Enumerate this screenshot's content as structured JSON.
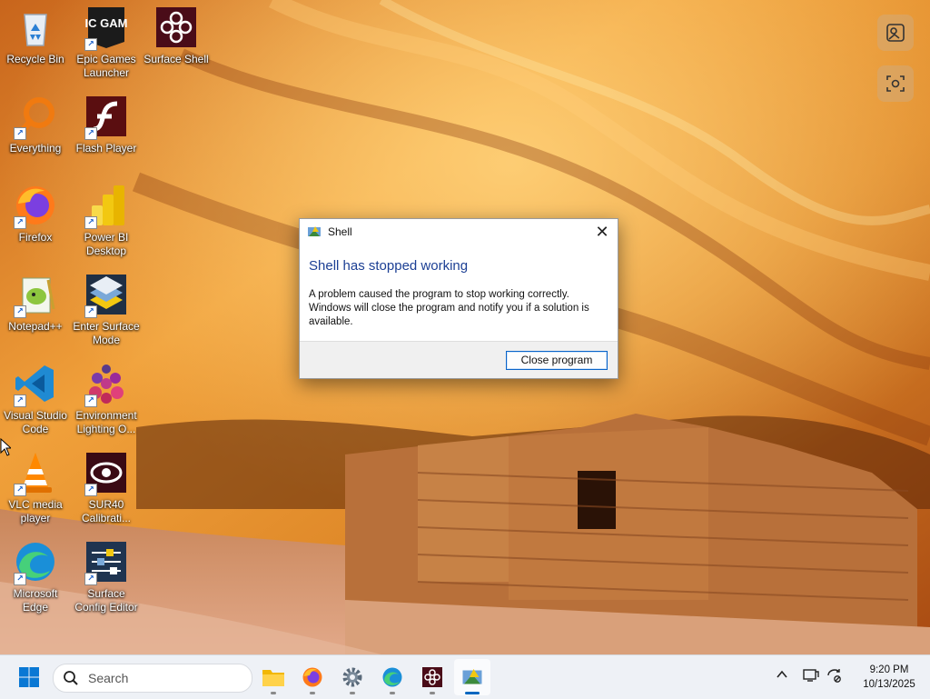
{
  "desktop": {
    "icons": [
      {
        "label": "Recycle Bin"
      },
      {
        "label": "Epic Games Launcher"
      },
      {
        "label": "Surface Shell"
      },
      {
        "label": "Everything"
      },
      {
        "label": "Flash Player"
      },
      {
        "label": "Firefox"
      },
      {
        "label": "Power BI Desktop"
      },
      {
        "label": "Notepad++"
      },
      {
        "label": "Enter Surface Mode"
      },
      {
        "label": "Visual Studio Code"
      },
      {
        "label": "Environment Lighting O..."
      },
      {
        "label": "VLC media player"
      },
      {
        "label": "SUR40 Calibrati..."
      },
      {
        "label": "Microsoft Edge"
      },
      {
        "label": "Surface Config Editor"
      }
    ],
    "epic_logo_text": "EPIC GAMES"
  },
  "dialog": {
    "title": "Shell",
    "heading": "Shell has stopped working",
    "message": "A problem caused the program to stop working correctly. Windows will close the program and notify you if a solution is available.",
    "close_button": "Close program",
    "close_glyph": "✕"
  },
  "taskbar": {
    "search_placeholder": "Search",
    "apps": [
      "file-explorer",
      "firefox",
      "settings",
      "microsoft-edge",
      "surface-shell",
      "shell-app"
    ],
    "active_app": "shell-app"
  },
  "tray": {
    "time": "9:20 PM",
    "date": "10/13/2025"
  },
  "colors": {
    "dialog_heading": "#1c3f94",
    "accent": "#0067c0"
  }
}
